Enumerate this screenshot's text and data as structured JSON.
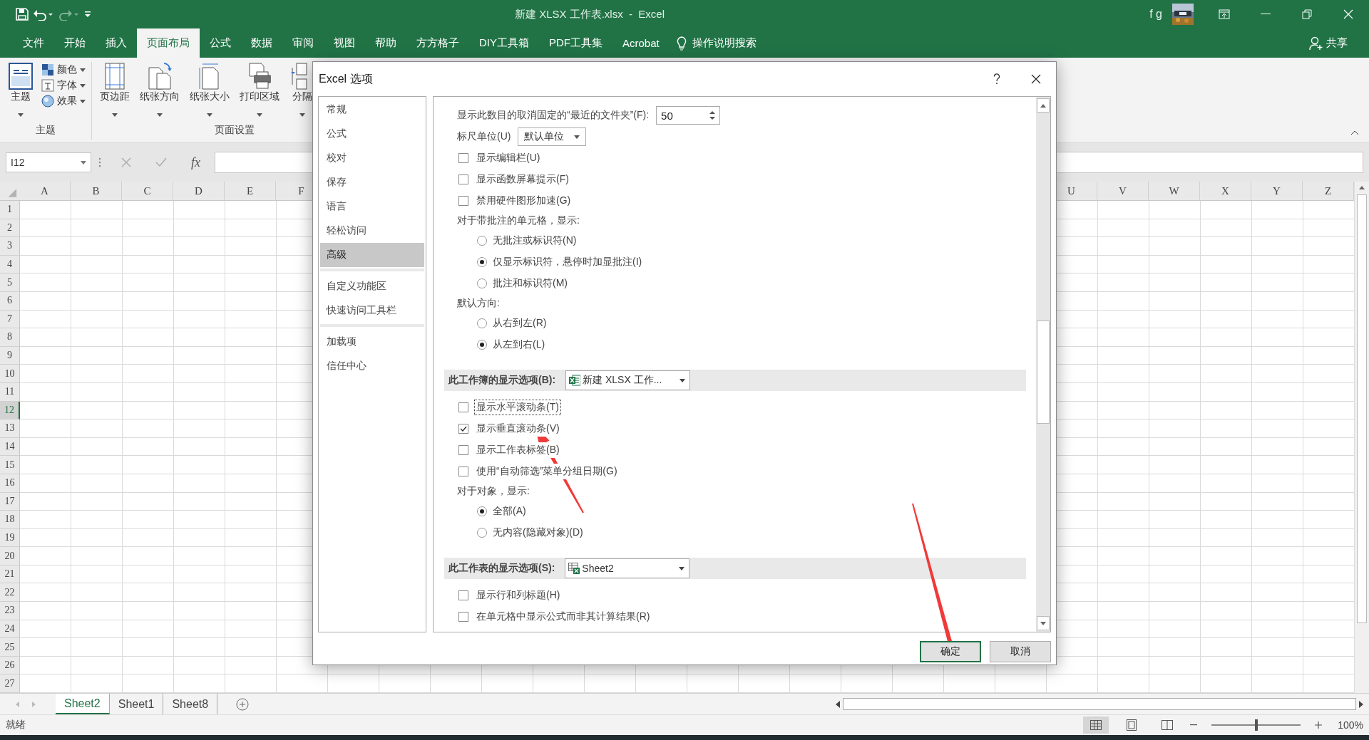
{
  "title_bar": {
    "title": "新建 XLSX 工作表.xlsx  -  Excel",
    "user": "f g"
  },
  "ribbon_tabs": [
    {
      "label": "文件",
      "selected": false
    },
    {
      "label": "开始",
      "selected": false
    },
    {
      "label": "插入",
      "selected": false
    },
    {
      "label": "页面布局",
      "selected": true
    },
    {
      "label": "公式",
      "selected": false
    },
    {
      "label": "数据",
      "selected": false
    },
    {
      "label": "审阅",
      "selected": false
    },
    {
      "label": "视图",
      "selected": false
    },
    {
      "label": "帮助",
      "selected": false
    },
    {
      "label": "方方格子",
      "selected": false
    },
    {
      "label": "DIY工具箱",
      "selected": false
    },
    {
      "label": "PDF工具集",
      "selected": false
    },
    {
      "label": "Acrobat",
      "selected": false
    }
  ],
  "tell_me": "操作说明搜索",
  "share": "共享",
  "ribbon_groups": [
    {
      "label": "主题",
      "commands": [
        {
          "kind": "large",
          "label": "主题"
        },
        {
          "kind": "small",
          "label": "颜色"
        },
        {
          "kind": "small",
          "label": "字体"
        },
        {
          "kind": "small",
          "label": "效果"
        }
      ]
    },
    {
      "label": "页面设置",
      "commands": [
        {
          "kind": "large",
          "label": "页边距"
        },
        {
          "kind": "large",
          "label": "纸张方向"
        },
        {
          "kind": "large",
          "label": "纸张大小"
        },
        {
          "kind": "large",
          "label": "打印区域"
        },
        {
          "kind": "large",
          "label": "分隔"
        }
      ]
    }
  ],
  "formula_bar": {
    "name_box": "I12",
    "function_label": "fx"
  },
  "grid": {
    "left_columns": [
      "A",
      "B",
      "C",
      "D",
      "E",
      "F"
    ],
    "right_columns": [
      "U",
      "V",
      "W",
      "X",
      "Y",
      "Z"
    ],
    "rows": [
      {
        "label": "1",
        "selected": false
      },
      {
        "label": "2",
        "selected": false
      },
      {
        "label": "3",
        "selected": false
      },
      {
        "label": "4",
        "selected": false
      },
      {
        "label": "5",
        "selected": false
      },
      {
        "label": "6",
        "selected": false
      },
      {
        "label": "7",
        "selected": false
      },
      {
        "label": "8",
        "selected": false
      },
      {
        "label": "9",
        "selected": false
      },
      {
        "label": "10",
        "selected": false
      },
      {
        "label": "11",
        "selected": false
      },
      {
        "label": "12",
        "selected": true
      },
      {
        "label": "13",
        "selected": false
      },
      {
        "label": "14",
        "selected": false
      },
      {
        "label": "15",
        "selected": false
      },
      {
        "label": "16",
        "selected": false
      },
      {
        "label": "17",
        "selected": false
      },
      {
        "label": "18",
        "selected": false
      },
      {
        "label": "19",
        "selected": false
      },
      {
        "label": "20",
        "selected": false
      },
      {
        "label": "21",
        "selected": false
      },
      {
        "label": "22",
        "selected": false
      },
      {
        "label": "23",
        "selected": false
      },
      {
        "label": "24",
        "selected": false
      },
      {
        "label": "25",
        "selected": false
      },
      {
        "label": "26",
        "selected": false
      },
      {
        "label": "27",
        "selected": false
      }
    ]
  },
  "sheet_tabs": [
    {
      "label": "Sheet2",
      "selected": true
    },
    {
      "label": "Sheet1",
      "selected": false
    },
    {
      "label": "Sheet8",
      "selected": false
    }
  ],
  "status_bar": {
    "text": "就绪",
    "zoom": "100%",
    "zoom_slider": {
      "level": 0.5
    }
  },
  "dialog": {
    "title": "Excel 选项",
    "nav_groups": [
      [
        {
          "label": "常规",
          "selected": false
        },
        {
          "label": "公式",
          "selected": false
        },
        {
          "label": "校对",
          "selected": false
        },
        {
          "label": "保存",
          "selected": false
        },
        {
          "label": "语言",
          "selected": false
        },
        {
          "label": "轻松访问",
          "selected": false
        },
        {
          "label": "高级",
          "selected": true
        }
      ],
      [
        {
          "label": "自定义功能区",
          "selected": false
        },
        {
          "label": "快速访问工具栏",
          "selected": false
        }
      ],
      [
        {
          "label": "加载项",
          "selected": false
        },
        {
          "label": "信任中心",
          "selected": false
        }
      ]
    ],
    "options": [
      {
        "kind": "number",
        "label": "显示此数目的取消固定的“最近的文件夹”(F):",
        "value": "50"
      },
      {
        "kind": "dropdown",
        "label": "标尺单位(U)",
        "value": "默认单位"
      },
      {
        "kind": "checkbox",
        "label": "显示编辑栏(U)",
        "checked": false,
        "focused": false
      },
      {
        "kind": "checkbox",
        "label": "显示函数屏幕提示(F)",
        "checked": false,
        "focused": false
      },
      {
        "kind": "checkbox",
        "label": "禁用硬件图形加速(G)",
        "checked": false,
        "focused": false
      },
      {
        "kind": "label",
        "label": "对于带批注的单元格，显示:"
      },
      {
        "kind": "radio",
        "label": "无批注或标识符(N)",
        "selected": false
      },
      {
        "kind": "radio",
        "label": "仅显示标识符，悬停时加显批注(I)",
        "selected": true
      },
      {
        "kind": "radio",
        "label": "批注和标识符(M)",
        "selected": false
      },
      {
        "kind": "label",
        "label": "默认方向:"
      },
      {
        "kind": "radio",
        "label": "从右到左(R)",
        "selected": false
      },
      {
        "kind": "radio",
        "label": "从左到右(L)",
        "selected": true
      },
      {
        "kind": "section",
        "label": "此工作簿的显示选项(B):",
        "value": "新建 XLSX 工作..."
      },
      {
        "kind": "checkbox",
        "label": "显示水平滚动条(T)",
        "checked": false,
        "focused": true
      },
      {
        "kind": "checkbox",
        "label": "显示垂直滚动条(V)",
        "checked": true,
        "focused": false
      },
      {
        "kind": "checkbox",
        "label": "显示工作表标签(B)",
        "checked": false,
        "focused": false
      },
      {
        "kind": "checkbox",
        "label": "使用“自动筛选”菜单分组日期(G)",
        "checked": false,
        "focused": false
      },
      {
        "kind": "label",
        "label": "对于对象，显示:"
      },
      {
        "kind": "radio",
        "label": "全部(A)",
        "selected": true
      },
      {
        "kind": "radio",
        "label": "无内容(隐藏对象)(D)",
        "selected": false
      },
      {
        "kind": "section",
        "label": "此工作表的显示选项(S):",
        "value": "Sheet2"
      },
      {
        "kind": "checkbox",
        "label": "显示行和列标题(H)",
        "checked": false,
        "focused": false
      },
      {
        "kind": "checkbox",
        "label": "在单元格中显示公式而非其计算结果(R)",
        "checked": false,
        "focused": false
      }
    ],
    "buttons": [
      {
        "label": "确定",
        "default": true
      },
      {
        "label": "取消",
        "default": false
      }
    ]
  }
}
